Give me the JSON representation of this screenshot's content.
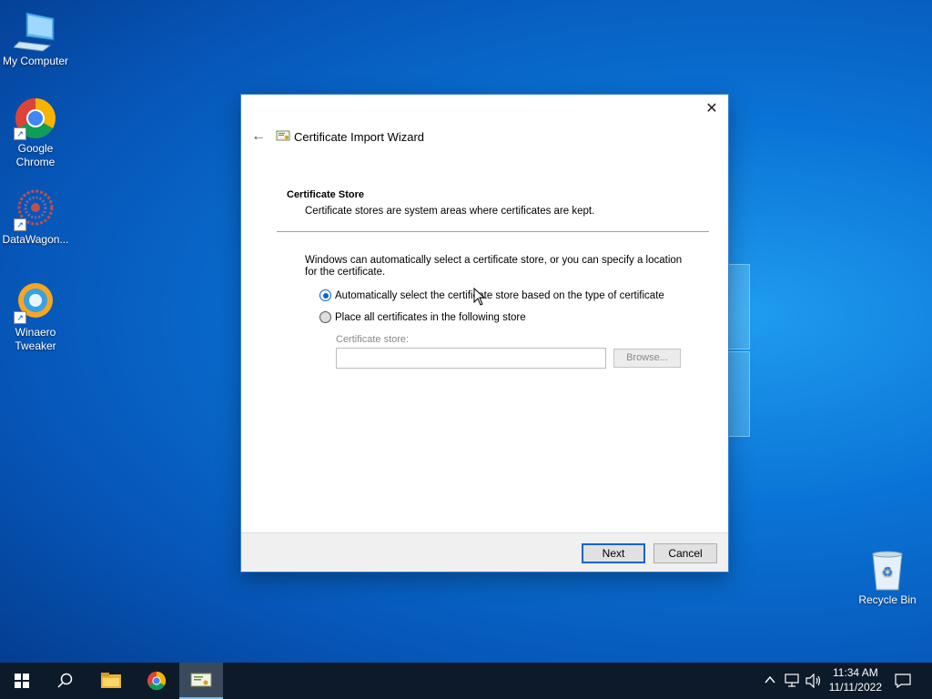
{
  "desktop": {
    "icons": [
      {
        "label": "My Computer",
        "icon": "computer-icon"
      },
      {
        "label": "Google Chrome",
        "icon": "chrome-icon"
      },
      {
        "label": "DataWagon...",
        "icon": "datawagon-icon"
      },
      {
        "label": "Winaero Tweaker",
        "icon": "winaero-icon"
      },
      {
        "label": "Recycle Bin",
        "icon": "recycle-bin-icon"
      }
    ]
  },
  "dialog": {
    "title": "Certificate Import Wizard",
    "close_glyph": "✕",
    "back_glyph": "←",
    "section_heading": "Certificate Store",
    "section_description": "Certificate stores are system areas where certificates are kept.",
    "intro": "Windows can automatically select a certificate store, or you can specify a location for the certificate.",
    "options": [
      {
        "label": "Automatically select the certificate store based on the type of certificate",
        "selected": true
      },
      {
        "label": "Place all certificates in the following store",
        "selected": false
      }
    ],
    "store_field_label": "Certificate store:",
    "store_field_value": "",
    "browse_label": "Browse...",
    "next_label": "Next",
    "cancel_label": "Cancel"
  },
  "taskbar": {
    "time": "11:34 AM",
    "date": "11/11/2022",
    "apps": [
      "start-icon",
      "search-icon",
      "file-explorer-icon",
      "chrome-icon",
      "certificate-wizard-icon"
    ],
    "tray": [
      "chevron-up-icon",
      "network-icon",
      "volume-icon",
      "notification-icon"
    ]
  },
  "colors": {
    "accent": "#0a64d8",
    "taskbar_bg": "#0c1a2a",
    "desktop_bg": "#0a74d6"
  }
}
